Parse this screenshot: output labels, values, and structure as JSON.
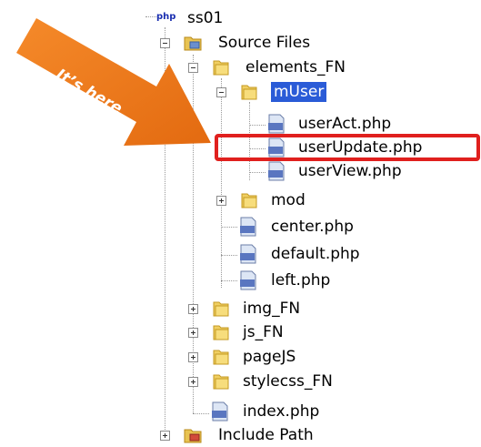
{
  "tree": {
    "root": {
      "label": "ss01",
      "icon": "php-project-icon"
    },
    "source_files": {
      "label": "Source Files",
      "expanded": true
    },
    "elements_fn": {
      "label": "elements_FN",
      "expanded": true
    },
    "muser": {
      "label": "mUser",
      "expanded": true,
      "selected": true
    },
    "muser_files": [
      {
        "label": "userAct.php"
      },
      {
        "label": "userUpdate.php"
      },
      {
        "label": "userView.php"
      }
    ],
    "mod": {
      "label": "mod",
      "expanded": false
    },
    "elements_files": [
      {
        "label": "center.php"
      },
      {
        "label": "default.php"
      },
      {
        "label": "left.php"
      }
    ],
    "folders": [
      {
        "label": "img_FN"
      },
      {
        "label": "js_FN"
      },
      {
        "label": "pageJS"
      },
      {
        "label": "stylecss_FN"
      }
    ],
    "index_file": {
      "label": "index.php"
    },
    "include_path": {
      "label": "Include Path",
      "expanded": false
    }
  },
  "callout": {
    "text": "It’s here",
    "color": "#f07f1f",
    "highlight_color": "#e0201e"
  }
}
